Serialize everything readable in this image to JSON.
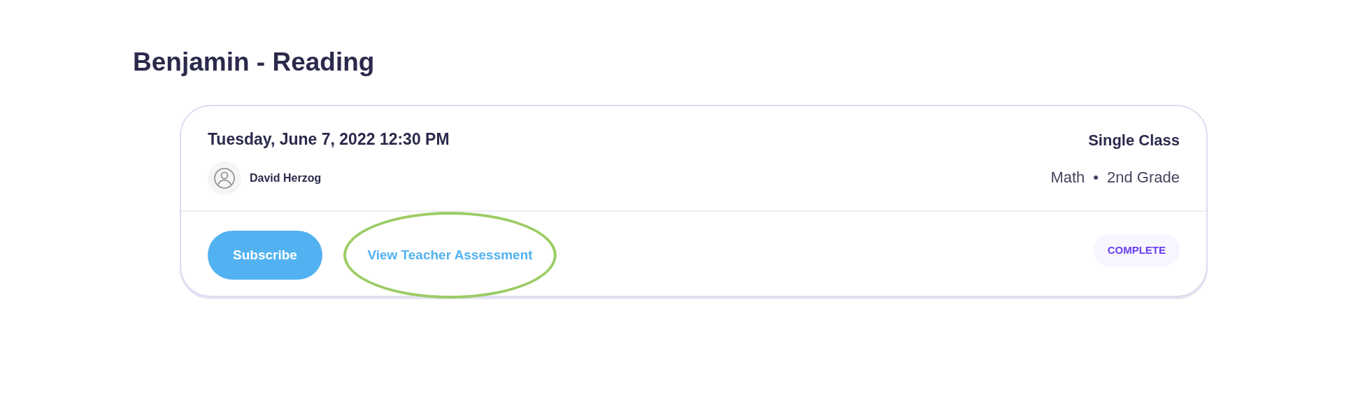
{
  "heading": "Benjamin - Reading",
  "session": {
    "datetime": "Tuesday, June 7, 2022 12:30 PM",
    "teacher": "David Herzog",
    "type": "Single Class",
    "subject": "Math",
    "separator": "•",
    "grade": "2nd Grade"
  },
  "actions": {
    "subscribe": "Subscribe",
    "assessment_link": "View Teacher Assessment",
    "link_highlighted": true
  },
  "status": "COMPLETE"
}
